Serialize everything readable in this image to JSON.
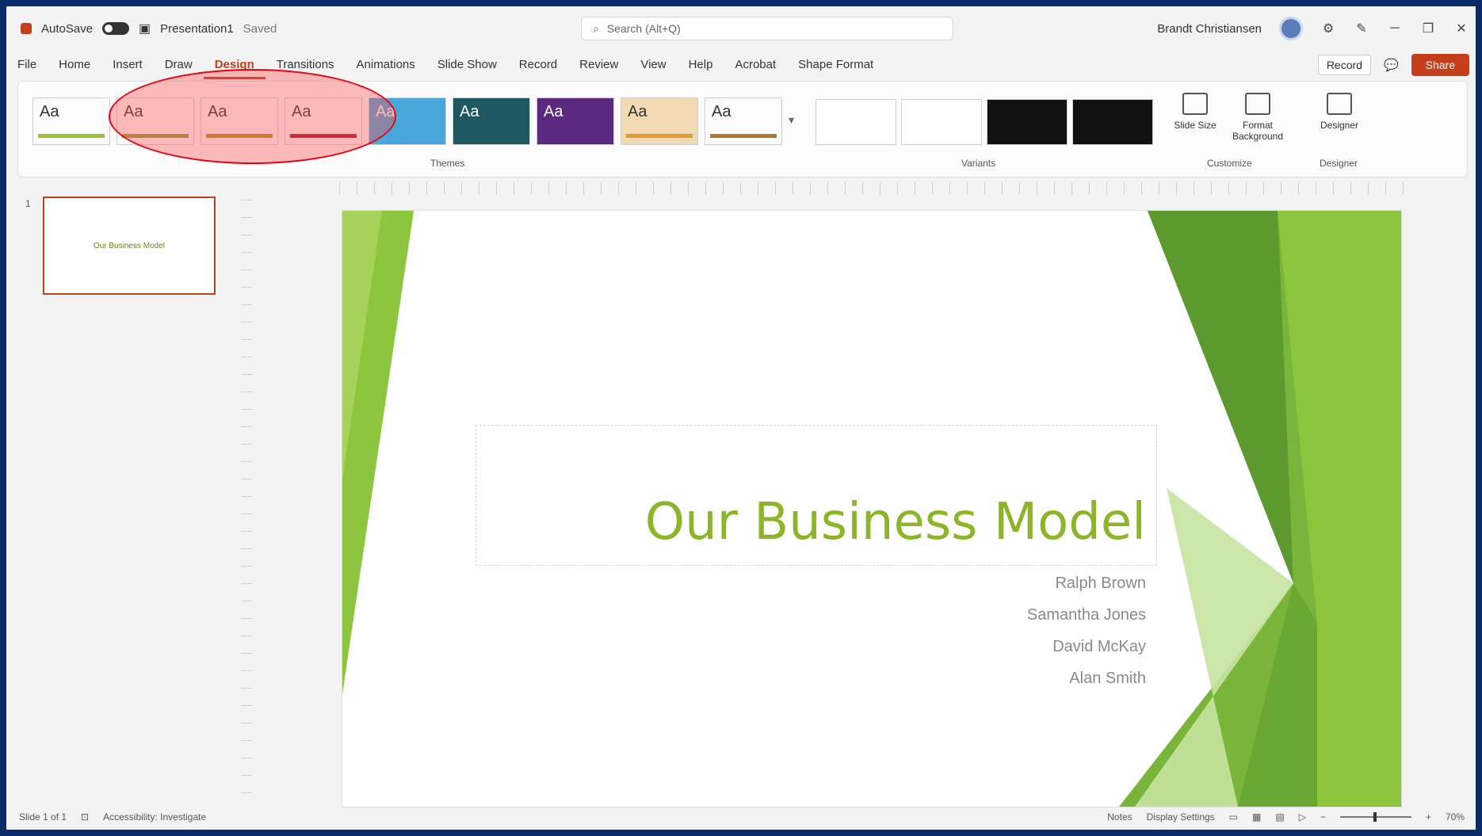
{
  "titlebar": {
    "autosave": "AutoSave",
    "file_name": "Presentation1",
    "saved_state": "Saved",
    "search_placeholder": "Search (Alt+Q)",
    "user_name": "Brandt Christiansen"
  },
  "tabs": [
    "File",
    "Home",
    "Insert",
    "Draw",
    "Design",
    "Transitions",
    "Animations",
    "Slide Show",
    "Record",
    "Review",
    "View",
    "Help",
    "Acrobat",
    "Shape Format"
  ],
  "active_tab": "Design",
  "tabs_right": {
    "record": "Record",
    "share": "Share"
  },
  "ribbon": {
    "themes": [
      {
        "label": "Aa",
        "color": "#9fbf3b"
      },
      {
        "label": "Aa",
        "color": "#8ea53a"
      },
      {
        "label": "Aa",
        "color": "#b9941f"
      },
      {
        "label": "Aa",
        "color": "#b2192f"
      },
      {
        "label": "Aa",
        "color": "#3ba3e0"
      },
      {
        "label": "Aa",
        "color": "#1e6a73"
      },
      {
        "label": "Aa",
        "color": "#6b2c91"
      },
      {
        "label": "Aa",
        "color": "#e09a36"
      },
      {
        "label": "Aa",
        "color": "#b07a2a"
      }
    ],
    "themes_group_label": "Themes",
    "variants_group_label": "Variants",
    "customize_group_label": "Customize",
    "designer_group_label": "Designer",
    "buttons": {
      "slide_size": "Slide Size",
      "format_background": "Format Background",
      "designer": "Designer"
    }
  },
  "thumbnail": {
    "number": "1",
    "caption": "Our Business Model"
  },
  "slide": {
    "title": "Our Business Model",
    "names": [
      "Ralph Brown",
      "Samantha Jones",
      "David McKay",
      "Alan Smith"
    ]
  },
  "statusbar": {
    "slide_info": "Slide 1 of 1",
    "accessibility": "Accessibility: Investigate",
    "notes": "Notes",
    "display_settings": "Display Settings",
    "zoom": "70%"
  },
  "colors": {
    "accent": "#c43e1c",
    "slide_green": "#8cb52a",
    "highlight": "#e60012"
  }
}
